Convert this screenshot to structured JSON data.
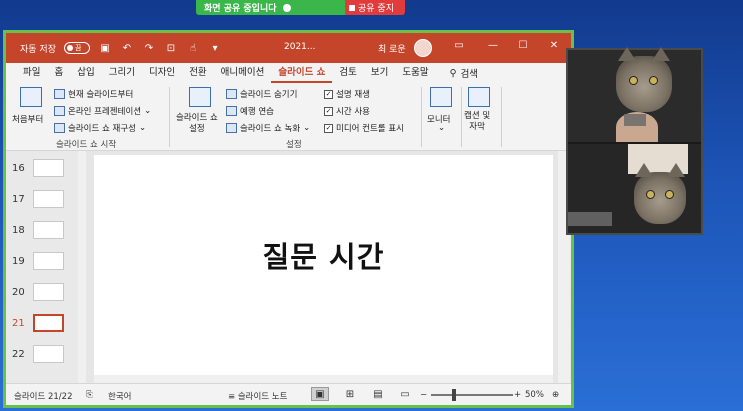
{
  "share": {
    "status": "화면 공유 중입니다",
    "stop": "공유 중지"
  },
  "titlebar": {
    "autosave": "자동 저장",
    "toggle": "끔",
    "file": "2021...",
    "user": "최 로운"
  },
  "menu": {
    "items": [
      "파일",
      "홈",
      "삽입",
      "그리기",
      "디자인",
      "전환",
      "애니메이션",
      "슬라이드 쇼",
      "검토",
      "보기",
      "도움말"
    ],
    "active": "슬라이드 쇼",
    "search": "검색"
  },
  "ribbon": {
    "from_start": "처음부터",
    "from_current": "현재 슬라이드부터",
    "online": "온라인 프레젠테이션",
    "custom": "슬라이드 쇼 재구성",
    "group1": "슬라이드 쇼 시작",
    "setup": "슬라이드 쇼\n설정",
    "hide": "슬라이드 숨기기",
    "rehearse": "예행 연습",
    "record": "슬라이드 쇼 녹화",
    "narration": "설명 재생",
    "timing": "시간 사용",
    "media": "미디어 컨트롤 표시",
    "group2": "설정",
    "monitor": "모니터",
    "captions": "캡션 및\n자막"
  },
  "thumbnails": [
    {
      "num": "16",
      "current": false
    },
    {
      "num": "17",
      "current": false
    },
    {
      "num": "18",
      "current": false
    },
    {
      "num": "19",
      "current": false
    },
    {
      "num": "20",
      "current": false
    },
    {
      "num": "21",
      "current": true
    },
    {
      "num": "22",
      "current": false
    }
  ],
  "slide": {
    "title": "질문 시간"
  },
  "status": {
    "slide": "슬라이드 21/22",
    "lang": "한국어",
    "notes": "슬라이드 노트",
    "zoom": "50%"
  }
}
